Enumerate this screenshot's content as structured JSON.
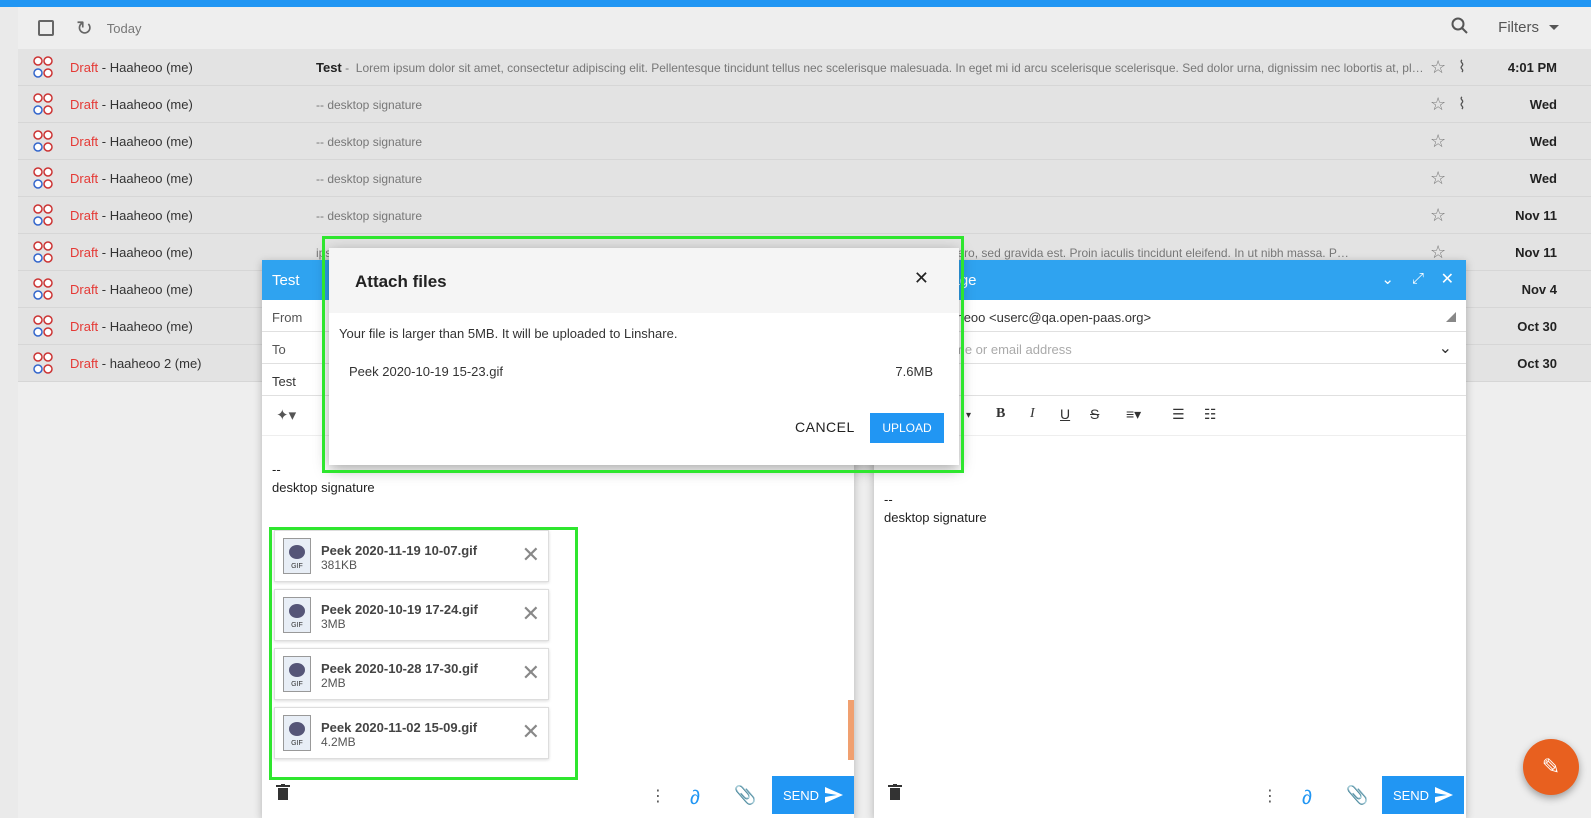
{
  "toolbar": {
    "today": "Today",
    "filters": "Filters"
  },
  "emails": [
    {
      "draft": "Draft",
      "sender": " - Haaheoo (me)",
      "subject": "Test",
      "preview": "Lorem ipsum dolor sit amet, consectetur adipiscing elit. Pellentesque tincidunt tellus nec scelerisque malesuada. In eget mi id arcu scelerisque scelerisque. Sed dolor urna, dignissim nec lobortis at, plac…",
      "date": "4:01 PM",
      "attachment": true
    },
    {
      "draft": "Draft",
      "sender": " - Haaheoo (me)",
      "subject": "",
      "preview": "-- desktop signature",
      "date": "Wed",
      "attachment": true
    },
    {
      "draft": "Draft",
      "sender": " - Haaheoo (me)",
      "subject": "",
      "preview": "-- desktop signature",
      "date": "Wed",
      "attachment": false
    },
    {
      "draft": "Draft",
      "sender": " - Haaheoo (me)",
      "subject": "",
      "preview": "-- desktop signature",
      "date": "Wed",
      "attachment": false
    },
    {
      "draft": "Draft",
      "sender": " - Haaheoo (me)",
      "subject": "",
      "preview": "-- desktop signature",
      "date": "Nov 11",
      "attachment": false
    },
    {
      "draft": "Draft",
      "sender": " - Haaheoo (me)",
      "subject": "",
      "preview": "ipsum dolor sit amet, consectetur adipiscing elit. Donec efficitur, purus a porttitor aliquam, ipsum lorem et. Ut ut dictum libero, sed gravida est. Proin iaculis tincidunt eleifend. In ut nibh massa. P…",
      "date": "Nov 11",
      "attachment": false
    },
    {
      "draft": "Draft",
      "sender": " - Haaheoo (me)",
      "subject": "",
      "preview": "",
      "date": "Nov 4",
      "attachment": false
    },
    {
      "draft": "Draft",
      "sender": " - Haaheoo (me)",
      "subject": "",
      "preview": "",
      "date": "Oct 30",
      "attachment": false
    },
    {
      "draft": "Draft",
      "sender": " - haaheoo 2 (me)",
      "subject": "",
      "preview": "",
      "date": "Oct 30",
      "attachment": false
    }
  ],
  "composer_left": {
    "title": "Test",
    "from_label": "From",
    "to_label": "To",
    "subject": "Test",
    "body_dash": "--",
    "body_signature": "desktop signature",
    "send": "SEND",
    "attachments": [
      {
        "name": "Peek 2020-11-19 10-07.gif",
        "size": "381KB"
      },
      {
        "name": "Peek 2020-10-19 17-24.gif",
        "size": "3MB"
      },
      {
        "name": "Peek 2020-10-28 17-30.gif",
        "size": "2MB"
      },
      {
        "name": "Peek 2020-11-02 15-09.gif",
        "size": "4.2MB"
      }
    ],
    "gif_label": "GIF"
  },
  "composer_right": {
    "title": "sage",
    "from_value": "aaheoo <userc@qa.open-paas.org>",
    "to_placeholder": "me or email address",
    "body_dash": "--",
    "body_signature": "desktop signature",
    "send": "SEND"
  },
  "dialog": {
    "title": "Attach files",
    "message": "Your file is larger than 5MB. It will be uploaded to Linshare.",
    "file_name": "Peek 2020-10-19 15-23.gif",
    "file_size": "7.6MB",
    "cancel": "CANCEL",
    "upload": "UPLOAD"
  },
  "colors": {
    "accent": "#2196f3",
    "draft": "#e53935",
    "highlight": "#2ee62e",
    "fab": "#e8601f"
  },
  "icons": [
    "checkbox-icon",
    "refresh-icon",
    "search-icon",
    "chevron-down-icon",
    "star-icon",
    "paperclip-icon",
    "trash-icon",
    "more-vert-icon",
    "link-icon",
    "send-icon",
    "close-icon",
    "pencil-icon",
    "expand-icon"
  ]
}
